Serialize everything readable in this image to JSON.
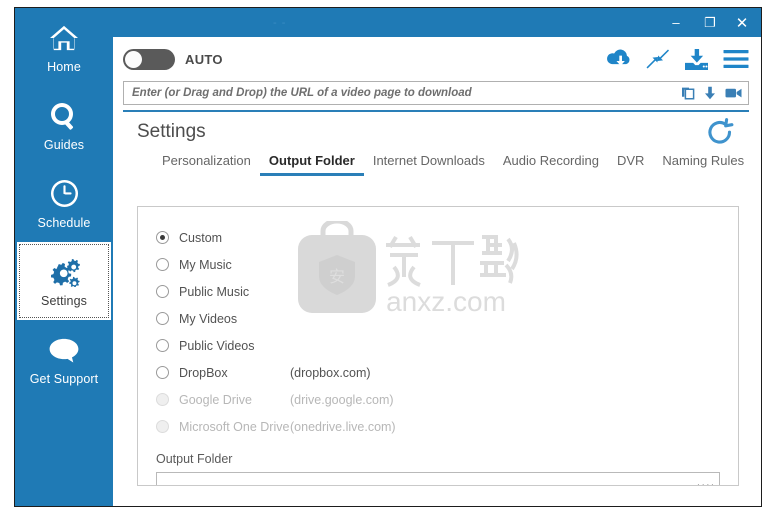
{
  "window": {
    "title_ghost": "- -",
    "controls": {
      "minimize": "–",
      "maximize": "❐",
      "close": "✕"
    }
  },
  "sidebar": {
    "items": [
      {
        "label": "Home",
        "icon": "home-icon",
        "active": false
      },
      {
        "label": "Guides",
        "icon": "search-icon",
        "active": false
      },
      {
        "label": "Schedule",
        "icon": "clock-icon",
        "active": false
      },
      {
        "label": "Settings",
        "icon": "gears-icon",
        "active": true
      },
      {
        "label": "Get Support",
        "icon": "chat-bubble-icon",
        "active": false
      }
    ]
  },
  "toolbar": {
    "auto_label": "AUTO",
    "auto_on": false,
    "icons": [
      {
        "name": "cloud-download-icon"
      },
      {
        "name": "collapse-arrows-icon"
      },
      {
        "name": "download-to-tray-icon"
      },
      {
        "name": "hamburger-menu-icon"
      }
    ]
  },
  "urlbar": {
    "value": "",
    "placeholder": "Enter (or Drag and Drop) the URL of a video page to download",
    "icons": [
      {
        "name": "paste-clipboard-icon"
      },
      {
        "name": "download-arrow-icon"
      },
      {
        "name": "video-camera-icon"
      }
    ]
  },
  "settings": {
    "title": "Settings",
    "refresh_icon": "reset-refresh-icon",
    "tabs": [
      {
        "label": "Personalization",
        "selected": false
      },
      {
        "label": "Output Folder",
        "selected": true
      },
      {
        "label": "Internet Downloads",
        "selected": false
      },
      {
        "label": "Audio Recording",
        "selected": false
      },
      {
        "label": "DVR",
        "selected": false
      },
      {
        "label": "Naming Rules",
        "selected": false
      }
    ]
  },
  "output_folder": {
    "options": [
      {
        "label": "Custom",
        "note": "",
        "checked": true,
        "disabled": false
      },
      {
        "label": "My Music",
        "note": "",
        "checked": false,
        "disabled": false
      },
      {
        "label": "Public Music",
        "note": "",
        "checked": false,
        "disabled": false
      },
      {
        "label": "My Videos",
        "note": "",
        "checked": false,
        "disabled": false
      },
      {
        "label": "Public Videos",
        "note": "",
        "checked": false,
        "disabled": false
      },
      {
        "label": "DropBox",
        "note": "(dropbox.com)",
        "checked": false,
        "disabled": false
      },
      {
        "label": "Google Drive",
        "note": "(drive.google.com)",
        "checked": false,
        "disabled": true
      },
      {
        "label": "Microsoft One Drive",
        "note": "(onedrive.live.com)",
        "checked": false,
        "disabled": true
      }
    ],
    "field_caption": "Output Folder",
    "field_value": "",
    "browse_label": "····"
  },
  "watermark": {
    "text": "anxz.com",
    "mark": "安"
  },
  "colors": {
    "brand_blue": "#1f7ab5",
    "accent_blue": "#2a7fb8",
    "icon_blue": "#1f85c8",
    "toggle_off": "#5a5a5a"
  }
}
